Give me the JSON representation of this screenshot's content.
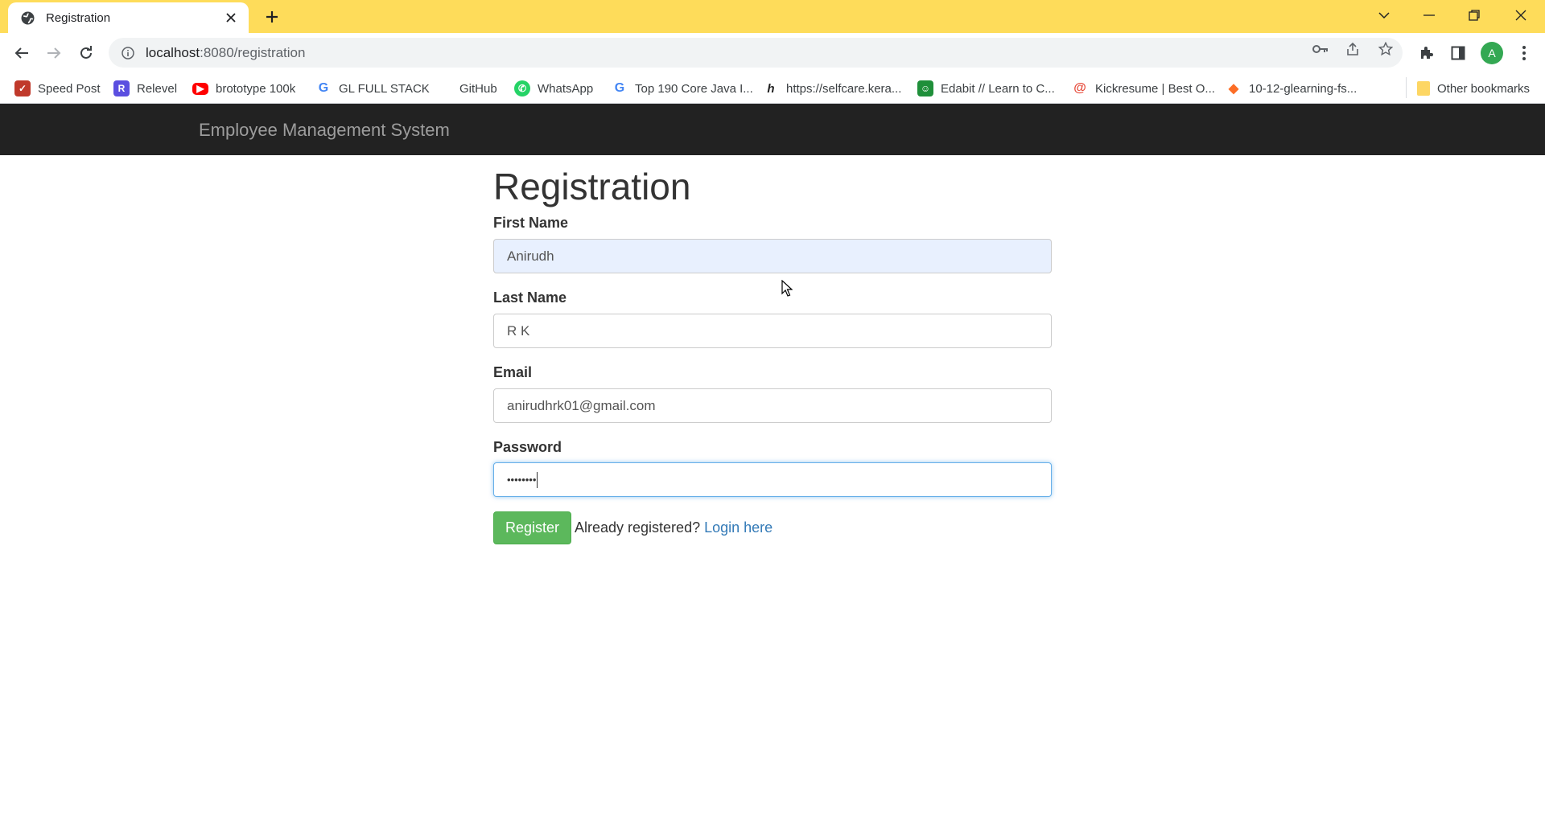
{
  "browser": {
    "tab_title": "Registration",
    "url_host": "localhost",
    "url_rest": ":8080/registration",
    "avatar_letter": "A",
    "bookmarks": [
      {
        "label": "Speed Post",
        "icon": "speed-post-icon",
        "color": "#c0392b"
      },
      {
        "label": "Relevel",
        "icon": "relevel-icon",
        "color": "#5b4fe0"
      },
      {
        "label": "brototype 100k",
        "icon": "youtube-icon",
        "color": "#ff0000"
      },
      {
        "label": "GL FULL STACK",
        "icon": "google-icon",
        "color": "#4285f4"
      },
      {
        "label": "GitHub",
        "icon": "",
        "color": ""
      },
      {
        "label": "WhatsApp",
        "icon": "whatsapp-icon",
        "color": "#25d366"
      },
      {
        "label": "Top 190 Core Java I...",
        "icon": "google-icon",
        "color": "#4285f4"
      },
      {
        "label": "https://selfcare.kera...",
        "icon": "selfcare-icon",
        "color": "#222222"
      },
      {
        "label": "Edabit // Learn to C...",
        "icon": "edabit-icon",
        "color": "#1f8f3a"
      },
      {
        "label": "Kickresume | Best O...",
        "icon": "kickresume-icon",
        "color": "#e74c3c"
      },
      {
        "label": "10-12-glearning-fs...",
        "icon": "gitlab-icon",
        "color": "#fc6d26"
      }
    ],
    "other_bookmarks": "Other bookmarks"
  },
  "page": {
    "brand": "Employee Management System",
    "heading": "Registration",
    "form": {
      "first_name_label": "First Name",
      "first_name_value": "Anirudh",
      "last_name_label": "Last Name",
      "last_name_value": "R K",
      "email_label": "Email",
      "email_value": "anirudhrk01@gmail.com",
      "password_label": "Password",
      "password_masked": "••••••••",
      "register_button": "Register",
      "already_text": "Already registered? ",
      "login_link": "Login here"
    }
  },
  "colors": {
    "tabstrip": "#fedc5a",
    "navbar": "#222222",
    "register_button": "#5cb85c",
    "link": "#337ab7"
  }
}
